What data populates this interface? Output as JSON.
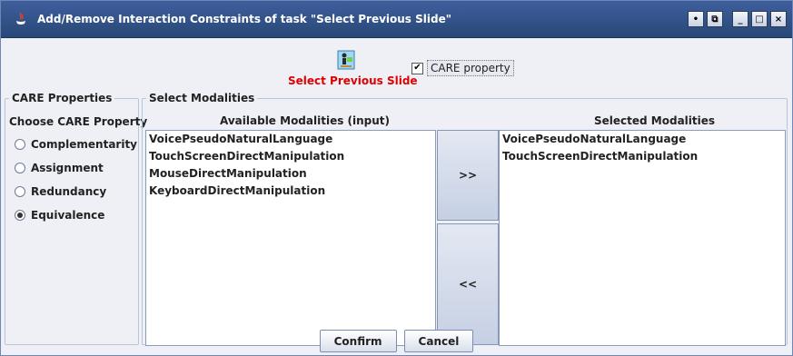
{
  "window": {
    "title": "Add/Remove Interaction Constraints of task \"Select Previous Slide\"",
    "controls": [
      "•",
      "⧉",
      "_",
      "□",
      "×"
    ]
  },
  "task": {
    "name": "Select Previous Slide",
    "care_checkbox_label": "CARE property",
    "care_checked": true
  },
  "care_panel": {
    "title": "CARE Properties",
    "choose_label": "Choose CARE Property",
    "options": [
      "Complementarity",
      "Assignment",
      "Redundancy",
      "Equivalence"
    ],
    "selected": "Equivalence"
  },
  "modalities_panel": {
    "title": "Select Modalities",
    "available_header": "Available Modalities (input)",
    "selected_header": "Selected Modalities",
    "available": [
      "VoicePseudoNaturalLanguage",
      "TouchScreenDirectManipulation",
      "MouseDirectManipulation",
      "KeyboardDirectManipulation"
    ],
    "selected": [
      "VoicePseudoNaturalLanguage",
      "TouchScreenDirectManipulation"
    ],
    "add_label": ">>",
    "remove_label": "<<"
  },
  "buttons": {
    "confirm": "Confirm",
    "cancel": "Cancel"
  },
  "colors": {
    "titlebar": "#3e5f9c",
    "task_name": "#e00000"
  }
}
